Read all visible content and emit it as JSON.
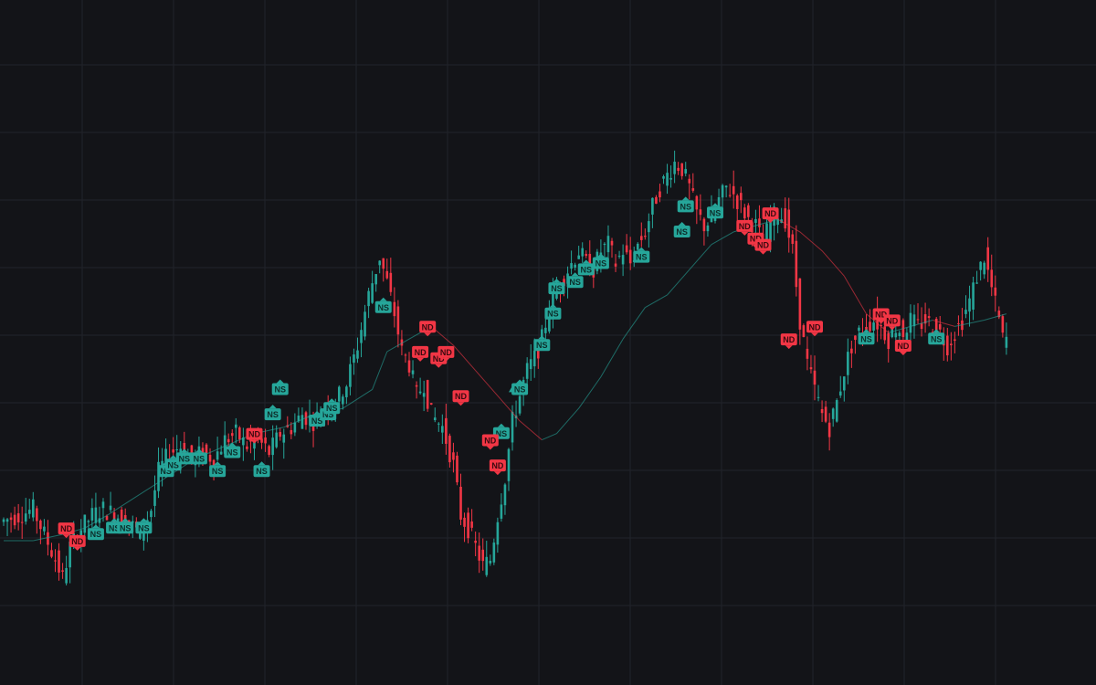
{
  "theme": {
    "background": "#131418",
    "grid": "#22242b",
    "up": "#26a69a",
    "down": "#f23645",
    "tag_text_ns": "#0d2e2b",
    "tag_text_nd": "#3a0a10"
  },
  "chart_data": {
    "type": "candlestick",
    "title": "",
    "xlabel": "",
    "ylabel": "",
    "grid": true,
    "legend": "none",
    "x_range": [
      0,
      275
    ],
    "ylim": [
      0,
      100
    ],
    "moving_average": {
      "name": "",
      "points": [
        [
          0,
          20
        ],
        [
          8,
          20
        ],
        [
          16,
          21
        ],
        [
          22,
          22
        ],
        [
          28,
          24
        ],
        [
          36,
          27
        ],
        [
          44,
          30
        ],
        [
          52,
          33
        ],
        [
          60,
          35
        ],
        [
          68,
          37
        ],
        [
          76,
          38
        ],
        [
          84,
          40
        ],
        [
          92,
          41
        ],
        [
          100,
          44
        ],
        [
          104,
          50
        ],
        [
          110,
          52
        ],
        [
          116,
          54
        ],
        [
          122,
          51
        ],
        [
          128,
          47
        ],
        [
          134,
          43
        ],
        [
          140,
          39
        ],
        [
          146,
          36
        ],
        [
          150,
          37
        ],
        [
          156,
          41
        ],
        [
          162,
          46
        ],
        [
          168,
          52
        ],
        [
          174,
          57
        ],
        [
          180,
          59
        ],
        [
          186,
          63
        ],
        [
          192,
          67
        ],
        [
          198,
          69
        ],
        [
          204,
          70
        ],
        [
          210,
          71
        ],
        [
          216,
          69
        ],
        [
          222,
          66
        ],
        [
          228,
          62
        ],
        [
          234,
          56
        ],
        [
          240,
          53
        ],
        [
          246,
          54
        ],
        [
          252,
          55
        ],
        [
          258,
          54
        ],
        [
          266,
          55
        ],
        [
          272,
          56
        ]
      ]
    },
    "candle_path": [
      [
        0,
        23
      ],
      [
        5,
        24
      ],
      [
        9,
        25
      ],
      [
        12,
        21
      ],
      [
        15,
        17
      ],
      [
        17,
        14
      ],
      [
        19,
        19
      ],
      [
        22,
        22
      ],
      [
        25,
        24
      ],
      [
        28,
        25
      ],
      [
        32,
        24
      ],
      [
        35,
        23
      ],
      [
        38,
        21
      ],
      [
        41,
        25
      ],
      [
        43,
        31
      ],
      [
        46,
        34
      ],
      [
        49,
        35
      ],
      [
        52,
        33
      ],
      [
        55,
        34
      ],
      [
        58,
        33
      ],
      [
        61,
        36
      ],
      [
        64,
        37
      ],
      [
        67,
        35
      ],
      [
        70,
        36
      ],
      [
        73,
        34
      ],
      [
        76,
        37
      ],
      [
        79,
        38
      ],
      [
        82,
        40
      ],
      [
        85,
        39
      ],
      [
        88,
        41
      ],
      [
        91,
        42
      ],
      [
        94,
        45
      ],
      [
        97,
        51
      ],
      [
        100,
        59
      ],
      [
        102,
        63
      ],
      [
        103,
        65
      ],
      [
        105,
        61
      ],
      [
        107,
        56
      ],
      [
        109,
        50
      ],
      [
        111,
        48
      ],
      [
        113,
        43
      ],
      [
        115,
        45
      ],
      [
        117,
        40
      ],
      [
        120,
        38
      ],
      [
        123,
        32
      ],
      [
        125,
        24
      ],
      [
        127,
        22
      ],
      [
        129,
        19
      ],
      [
        131,
        16
      ],
      [
        133,
        17
      ],
      [
        135,
        24
      ],
      [
        137,
        30
      ],
      [
        139,
        39
      ],
      [
        141,
        43
      ],
      [
        143,
        47
      ],
      [
        145,
        49
      ],
      [
        147,
        52
      ],
      [
        149,
        57
      ],
      [
        151,
        60
      ],
      [
        153,
        62
      ],
      [
        155,
        64
      ],
      [
        157,
        66
      ],
      [
        159,
        64
      ],
      [
        161,
        63
      ],
      [
        163,
        66
      ],
      [
        165,
        67
      ],
      [
        167,
        64
      ],
      [
        169,
        66
      ],
      [
        171,
        64
      ],
      [
        173,
        67
      ],
      [
        175,
        69
      ],
      [
        177,
        73
      ],
      [
        179,
        76
      ],
      [
        181,
        78
      ],
      [
        183,
        80
      ],
      [
        185,
        79
      ],
      [
        187,
        76
      ],
      [
        189,
        72
      ],
      [
        191,
        70
      ],
      [
        193,
        71
      ],
      [
        195,
        74
      ],
      [
        197,
        76
      ],
      [
        199,
        75
      ],
      [
        201,
        73
      ],
      [
        203,
        71
      ],
      [
        205,
        70
      ],
      [
        207,
        67
      ],
      [
        209,
        71
      ],
      [
        211,
        72
      ],
      [
        213,
        71
      ],
      [
        215,
        66
      ],
      [
        217,
        55
      ],
      [
        219,
        48
      ],
      [
        221,
        44
      ],
      [
        223,
        40
      ],
      [
        225,
        38
      ],
      [
        227,
        42
      ],
      [
        229,
        47
      ],
      [
        231,
        51
      ],
      [
        233,
        53
      ],
      [
        235,
        54
      ],
      [
        237,
        55
      ],
      [
        239,
        54
      ],
      [
        241,
        52
      ],
      [
        243,
        54
      ],
      [
        245,
        53
      ],
      [
        247,
        55
      ],
      [
        249,
        54
      ],
      [
        251,
        55
      ],
      [
        253,
        54
      ],
      [
        255,
        53
      ],
      [
        257,
        51
      ],
      [
        259,
        53
      ],
      [
        261,
        55
      ],
      [
        263,
        58
      ],
      [
        265,
        62
      ],
      [
        267,
        65
      ],
      [
        269,
        60
      ],
      [
        271,
        55
      ],
      [
        272,
        52
      ]
    ],
    "signals": [
      {
        "label": "NS",
        "bar": 25,
        "value": 22,
        "type": "up"
      },
      {
        "label": "NS",
        "bar": 30,
        "value": 23,
        "type": "up"
      },
      {
        "label": "NS",
        "bar": 33,
        "value": 23,
        "type": "up"
      },
      {
        "label": "NS",
        "bar": 38,
        "value": 23,
        "type": "up"
      },
      {
        "label": "NS",
        "bar": 44,
        "value": 32,
        "type": "up"
      },
      {
        "label": "NS",
        "bar": 46,
        "value": 33,
        "type": "up"
      },
      {
        "label": "NS",
        "bar": 49,
        "value": 34,
        "type": "up"
      },
      {
        "label": "NS",
        "bar": 53,
        "value": 34,
        "type": "up"
      },
      {
        "label": "NS",
        "bar": 58,
        "value": 32,
        "type": "up"
      },
      {
        "label": "NS",
        "bar": 62,
        "value": 35,
        "type": "up"
      },
      {
        "label": "NS",
        "bar": 70,
        "value": 32,
        "type": "up"
      },
      {
        "label": "NS",
        "bar": 73,
        "value": 41,
        "type": "up"
      },
      {
        "label": "NS",
        "bar": 75,
        "value": 45,
        "type": "up"
      },
      {
        "label": "NS",
        "bar": 85,
        "value": 40,
        "type": "up"
      },
      {
        "label": "NS",
        "bar": 88,
        "value": 41,
        "type": "up"
      },
      {
        "label": "NS",
        "bar": 89,
        "value": 42,
        "type": "up"
      },
      {
        "label": "NS",
        "bar": 103,
        "value": 58,
        "type": "up"
      },
      {
        "label": "NS",
        "bar": 135,
        "value": 38,
        "type": "up"
      },
      {
        "label": "NS",
        "bar": 140,
        "value": 45,
        "type": "up"
      },
      {
        "label": "NS",
        "bar": 146,
        "value": 52,
        "type": "up"
      },
      {
        "label": "NS",
        "bar": 149,
        "value": 57,
        "type": "up"
      },
      {
        "label": "NS",
        "bar": 150,
        "value": 61,
        "type": "up"
      },
      {
        "label": "NS",
        "bar": 155,
        "value": 62,
        "type": "up"
      },
      {
        "label": "NS",
        "bar": 158,
        "value": 64,
        "type": "up"
      },
      {
        "label": "NS",
        "bar": 162,
        "value": 65,
        "type": "up"
      },
      {
        "label": "NS",
        "bar": 173,
        "value": 66,
        "type": "up"
      },
      {
        "label": "NS",
        "bar": 184,
        "value": 70,
        "type": "up"
      },
      {
        "label": "NS",
        "bar": 185,
        "value": 74,
        "type": "up"
      },
      {
        "label": "NS",
        "bar": 193,
        "value": 73,
        "type": "up"
      },
      {
        "label": "NS",
        "bar": 253,
        "value": 53,
        "type": "up"
      },
      {
        "label": "NS",
        "bar": 234,
        "value": 53,
        "type": "up"
      },
      {
        "label": "ND",
        "bar": 17,
        "value": 21,
        "type": "down"
      },
      {
        "label": "ND",
        "bar": 20,
        "value": 19,
        "type": "down"
      },
      {
        "label": "ND",
        "bar": 68,
        "value": 36,
        "type": "down"
      },
      {
        "label": "ND",
        "bar": 115,
        "value": 53,
        "type": "down"
      },
      {
        "label": "ND",
        "bar": 113,
        "value": 49,
        "type": "down"
      },
      {
        "label": "ND",
        "bar": 118,
        "value": 48,
        "type": "down"
      },
      {
        "label": "ND",
        "bar": 120,
        "value": 49,
        "type": "down"
      },
      {
        "label": "ND",
        "bar": 124,
        "value": 42,
        "type": "down"
      },
      {
        "label": "ND",
        "bar": 132,
        "value": 35,
        "type": "down"
      },
      {
        "label": "ND",
        "bar": 134,
        "value": 31,
        "type": "down"
      },
      {
        "label": "ND",
        "bar": 201,
        "value": 69,
        "type": "down"
      },
      {
        "label": "ND",
        "bar": 204,
        "value": 67,
        "type": "down"
      },
      {
        "label": "ND",
        "bar": 206,
        "value": 66,
        "type": "down"
      },
      {
        "label": "ND",
        "bar": 208,
        "value": 71,
        "type": "down"
      },
      {
        "label": "ND",
        "bar": 213,
        "value": 51,
        "type": "down"
      },
      {
        "label": "ND",
        "bar": 220,
        "value": 53,
        "type": "down"
      },
      {
        "label": "ND",
        "bar": 238,
        "value": 55,
        "type": "down"
      },
      {
        "label": "ND",
        "bar": 241,
        "value": 54,
        "type": "down"
      },
      {
        "label": "ND",
        "bar": 244,
        "value": 50,
        "type": "down"
      }
    ],
    "markers": [
      {
        "type": "triangle-up",
        "bar": 138,
        "value": 44
      }
    ]
  }
}
